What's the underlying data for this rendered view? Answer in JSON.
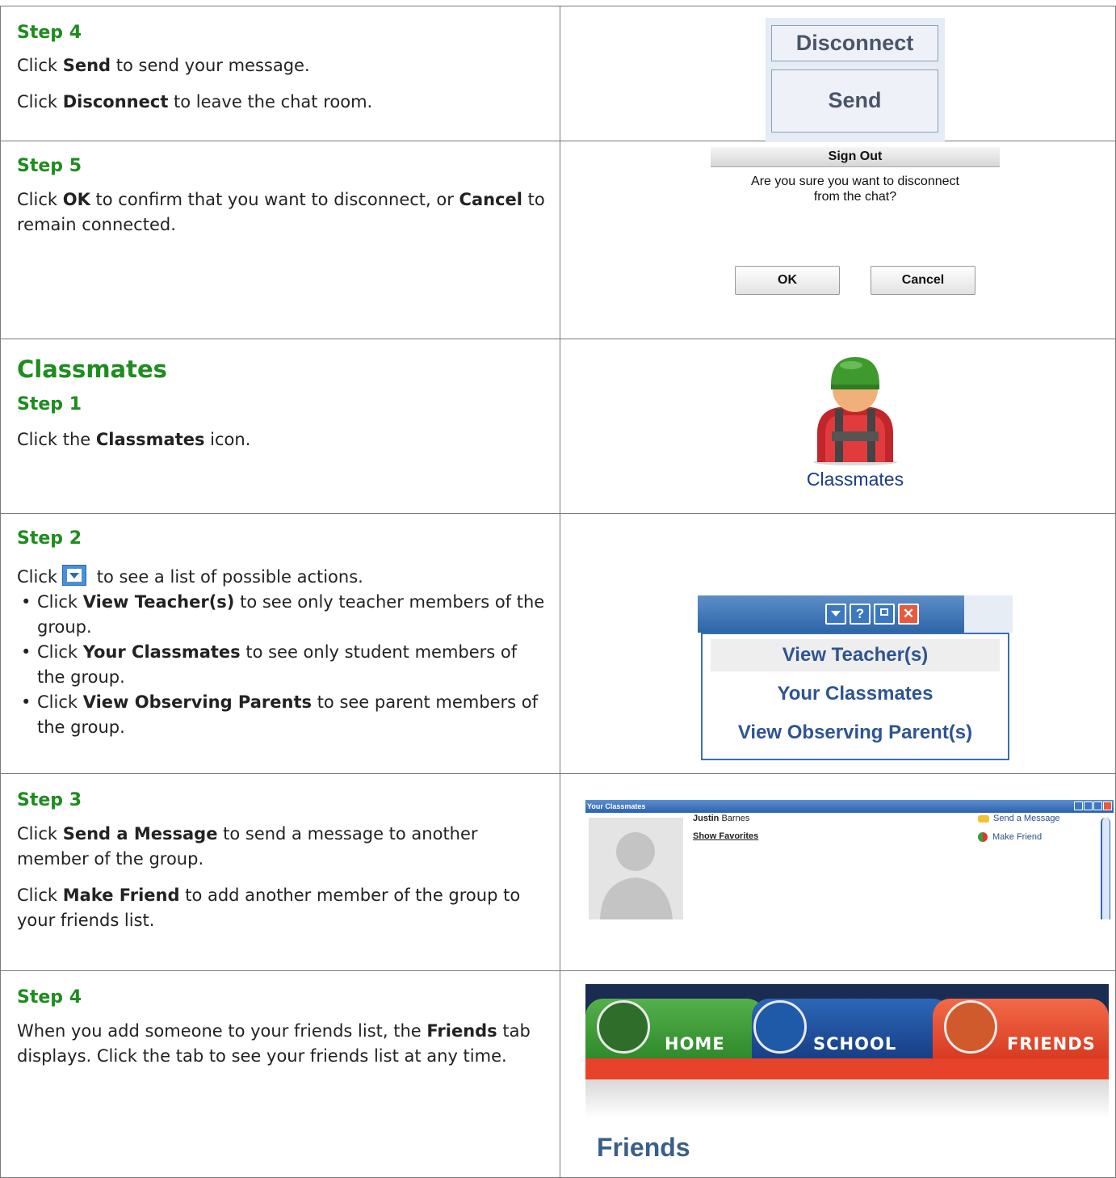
{
  "rows": {
    "r1": {
      "step": "Step 4",
      "lines": [
        {
          "pre": "Click ",
          "bold": "Send",
          "post": " to send your message."
        },
        {
          "pre": "Click ",
          "bold": "Disconnect",
          "post": " to leave the chat room."
        }
      ],
      "buttons": {
        "disconnect": "Disconnect",
        "send": "Send"
      }
    },
    "r2": {
      "step": "Step 5",
      "pre": "Click ",
      "bold1": "OK",
      "mid": " to confirm that you want to disconnect, or ",
      "bold2": "Cancel",
      "post": " to remain connected.",
      "dialog": {
        "title": "Sign Out",
        "message_line1": "Are you sure you want to disconnect",
        "message_line2": "from the chat?",
        "ok": "OK",
        "cancel": "Cancel"
      }
    },
    "r3": {
      "section": "Classmates",
      "step": "Step 1",
      "pre": "Click the ",
      "bold": "Classmates",
      "post": " icon.",
      "icon_label": "Classmates"
    },
    "r4": {
      "step": "Step 2",
      "click_pre": "Click",
      "click_post": " to see a list of possible actions.",
      "bullets": [
        {
          "pre": "Click ",
          "bold": "View Teacher(s)",
          "post": " to see only teacher members of the group."
        },
        {
          "pre": "Click ",
          "bold": "Your Classmates",
          "post": " to see only student members of the group."
        },
        {
          "pre": "Click ",
          "bold": "View Observing Parents",
          "post": " to see parent members of the group."
        }
      ],
      "window_buttons": {
        "help": "?"
      },
      "menu": [
        "View Teacher(s)",
        "Your Classmates",
        "View Observing Parent(s)"
      ]
    },
    "r5": {
      "step": "Step 3",
      "p1": {
        "pre": "Click ",
        "bold": "Send a Message",
        "post": " to send a message to another member of the group."
      },
      "p2": {
        "pre": "Click ",
        "bold": "Make Friend",
        "post": " to add another member of the group to your friends list."
      },
      "panel": {
        "title": "Your Classmates",
        "first_name": "Justin",
        "last_name": "Barnes",
        "show_favorites": "Show Favorites",
        "send_message": "Send a Message",
        "make_friend": "Make Friend"
      }
    },
    "r6": {
      "step": "Step 4",
      "pre": "When you add someone to your friends list, the ",
      "bold": "Friends",
      "post": " tab displays. Click the tab to see your friends list at any time.",
      "tabs": [
        "HOME",
        "SCHOOL",
        "FRIENDS"
      ],
      "heading": "Friends"
    }
  },
  "colors": {
    "step_green": "#1e8c1e",
    "button_blue_text": "#4a5568",
    "menu_blue": "#2e5592",
    "tab_home": "#3f9a3a",
    "tab_school": "#1f4e9a",
    "tab_friends": "#e6432a"
  }
}
